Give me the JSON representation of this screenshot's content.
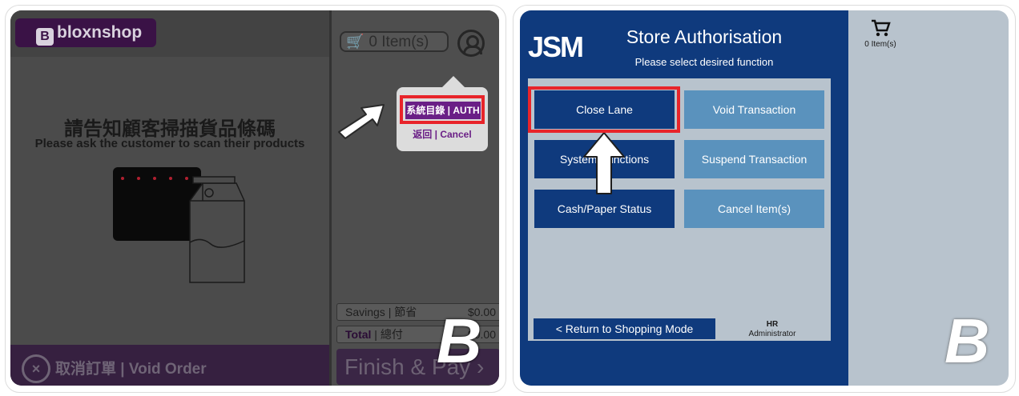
{
  "left": {
    "brand": "bloxnshop",
    "brand_icon": "B",
    "cart_count": "0 Item(s)",
    "popup": {
      "auth_label": "系統目錄 | AUTH",
      "cancel_label": "返回 | Cancel"
    },
    "instruction_zh": "請告知顧客掃描貨品條碼",
    "instruction_en": "Please ask the customer to scan their products",
    "savings": {
      "label": "Savings | 節省",
      "value": "$0.00"
    },
    "total": {
      "label_en": "Total",
      "label_zh": " | 總付",
      "value": "$0.00"
    },
    "void_order": "取消訂單 | Void Order",
    "void_icon": "×",
    "finish_pay": "Finish & Pay ›"
  },
  "right": {
    "brand": "JSM",
    "title": "Store Authorisation",
    "subtitle": "Please select desired function",
    "buttons": [
      {
        "label": "Close Lane"
      },
      {
        "label": "Void Transaction"
      },
      {
        "label": "System Functions"
      },
      {
        "label": "Suspend Transaction"
      },
      {
        "label": "Cash/Paper Status"
      },
      {
        "label": "Cancel Item(s)"
      }
    ],
    "return_label": "< Return to Shopping Mode",
    "user_name": "HR",
    "user_role": "Administrator",
    "cart_count": "0 Item(s)"
  },
  "watermark": "B",
  "colors": {
    "highlight": "#e8242a",
    "brand_purple": "#6a1f86",
    "jsm_blue": "#0f3a7d",
    "jsm_light": "#5a92bd"
  }
}
